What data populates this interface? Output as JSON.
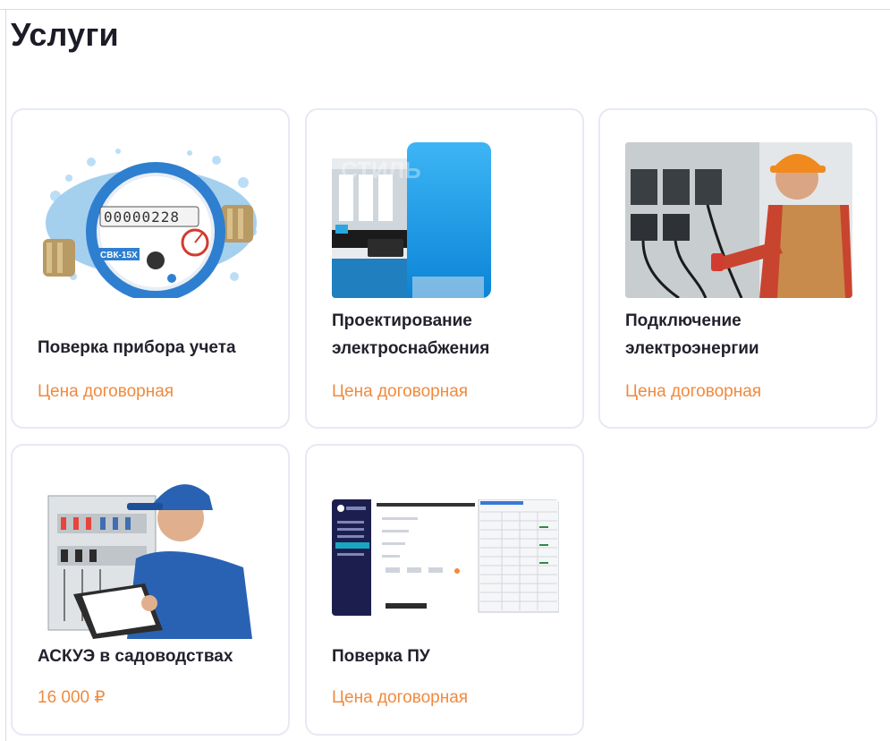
{
  "page": {
    "title": "Услуги"
  },
  "services": [
    {
      "name": "Поверка прибора учета",
      "price": "Цена договорная",
      "image": "water-meter-image",
      "meter_digits": "00000228",
      "meter_label": "СВК-15Х"
    },
    {
      "name": "Проектирование электроснабжения",
      "name_line1": "Проектирование",
      "name_line2": "электроснабжения",
      "price": "Цена договорная",
      "image": "interior-design-image"
    },
    {
      "name": "Подключение электроэнергии",
      "name_line1": "Подключение",
      "name_line2": "электроэнергии",
      "price": "Цена договорная",
      "image": "electrician-panel-image"
    },
    {
      "name": "АСКУЭ в садоводствах",
      "price": "16 000 ₽",
      "image": "technician-clipboard-image"
    },
    {
      "name": "Поверка ПУ",
      "price": "Цена договорная",
      "image": "software-screenshot-image"
    }
  ],
  "colors": {
    "price": "#f08a3e",
    "card_border": "#e7e9f3",
    "title": "#1c1c28"
  }
}
